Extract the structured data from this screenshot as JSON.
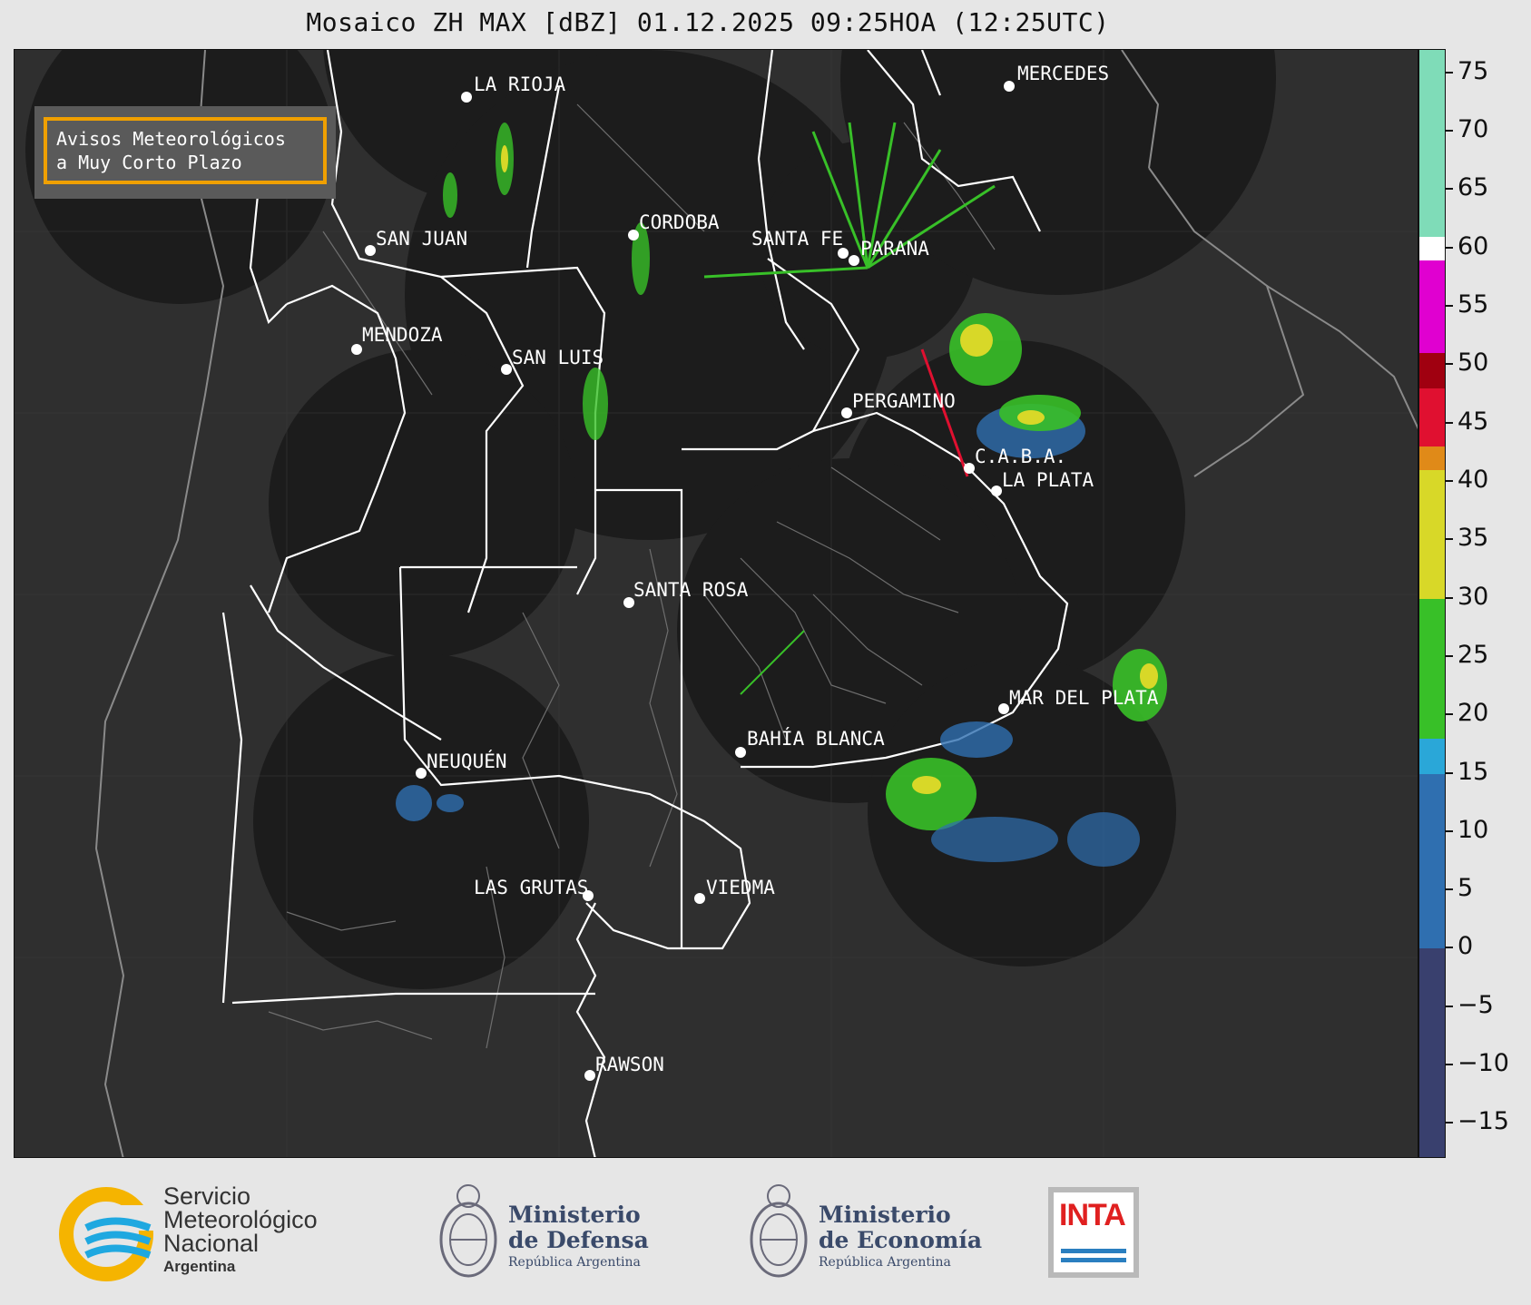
{
  "title": "Mosaico ZH MAX [dBZ] 01.12.2025 09:25HOA (12:25UTC)",
  "label_box": {
    "line1": "Avisos Meteorológicos",
    "line2": "a Muy Corto Plazo"
  },
  "cities": [
    {
      "name": "LA RIOJA"
    },
    {
      "name": "SAN JUAN"
    },
    {
      "name": "CORDOBA"
    },
    {
      "name": "SANTA FE"
    },
    {
      "name": "PARANA"
    },
    {
      "name": "MERCEDES"
    },
    {
      "name": "MENDOZA"
    },
    {
      "name": "SAN LUIS"
    },
    {
      "name": "PERGAMINO"
    },
    {
      "name": "C.A.B.A."
    },
    {
      "name": "LA PLATA"
    },
    {
      "name": "SANTA ROSA"
    },
    {
      "name": "MAR DEL PLATA"
    },
    {
      "name": "BAHÍA BLANCA"
    },
    {
      "name": "NEUQUÉN"
    },
    {
      "name": "LAS GRUTAS"
    },
    {
      "name": "VIEDMA"
    },
    {
      "name": "RAWSON"
    }
  ],
  "colorbar": {
    "unit": "dBZ",
    "ticks": [
      "75",
      "70",
      "65",
      "60",
      "55",
      "50",
      "45",
      "40",
      "35",
      "30",
      "25",
      "20",
      "15",
      "10",
      "5",
      "0",
      "−5",
      "−10",
      "−15"
    ],
    "range": [
      -18,
      77
    ],
    "colors": {
      "low": "#39406e",
      "blue": "#2f6fb0",
      "cyan": "#2aa7d8",
      "green": "#38c028",
      "yellow": "#d8d828",
      "orange": "#e08a18",
      "red": "#e01030",
      "darkred": "#a00010",
      "magenta": "#e000d0",
      "white": "#ffffff",
      "teal": "#7fdcb8"
    }
  },
  "logos": {
    "smn": {
      "line1": "Servicio",
      "line2": "Meteorológico",
      "line3": "Nacional",
      "line4": "Argentina"
    },
    "defensa": {
      "line1": "Ministerio",
      "line2": "de Defensa",
      "line3": "República Argentina"
    },
    "economia": {
      "line1": "Ministerio",
      "line2": "de Economía",
      "line3": "República Argentina"
    },
    "inta": {
      "text": "INTA"
    }
  }
}
